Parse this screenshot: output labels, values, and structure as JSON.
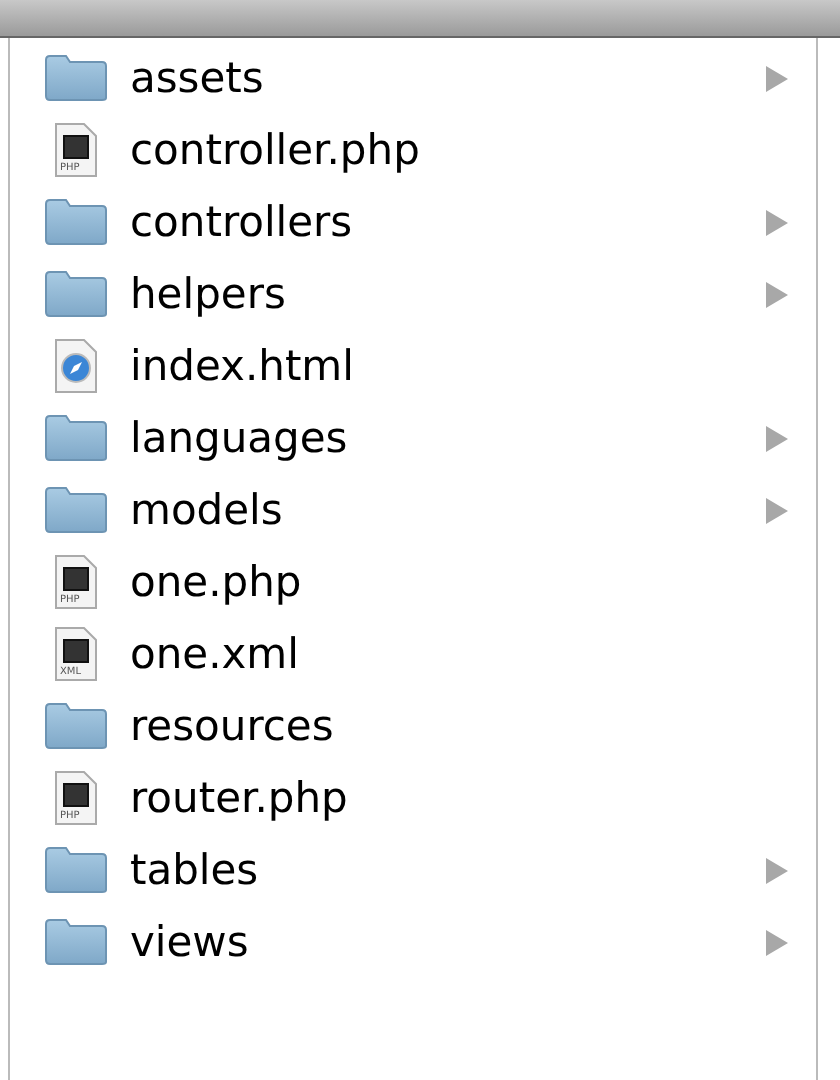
{
  "items": [
    {
      "name": "assets",
      "kind": "folder",
      "expandable": true
    },
    {
      "name": "controller.php",
      "kind": "file",
      "icon_label": "PHP"
    },
    {
      "name": "controllers",
      "kind": "folder",
      "expandable": true
    },
    {
      "name": "helpers",
      "kind": "folder",
      "expandable": true
    },
    {
      "name": "index.html",
      "kind": "webpage"
    },
    {
      "name": "languages",
      "kind": "folder",
      "expandable": true
    },
    {
      "name": "models",
      "kind": "folder",
      "expandable": true
    },
    {
      "name": "one.php",
      "kind": "file",
      "icon_label": "PHP"
    },
    {
      "name": "one.xml",
      "kind": "file",
      "icon_label": "XML"
    },
    {
      "name": "resources",
      "kind": "folder",
      "expandable": false
    },
    {
      "name": "router.php",
      "kind": "file",
      "icon_label": "PHP"
    },
    {
      "name": "tables",
      "kind": "folder",
      "expandable": true
    },
    {
      "name": "views",
      "kind": "folder",
      "expandable": true
    }
  ]
}
